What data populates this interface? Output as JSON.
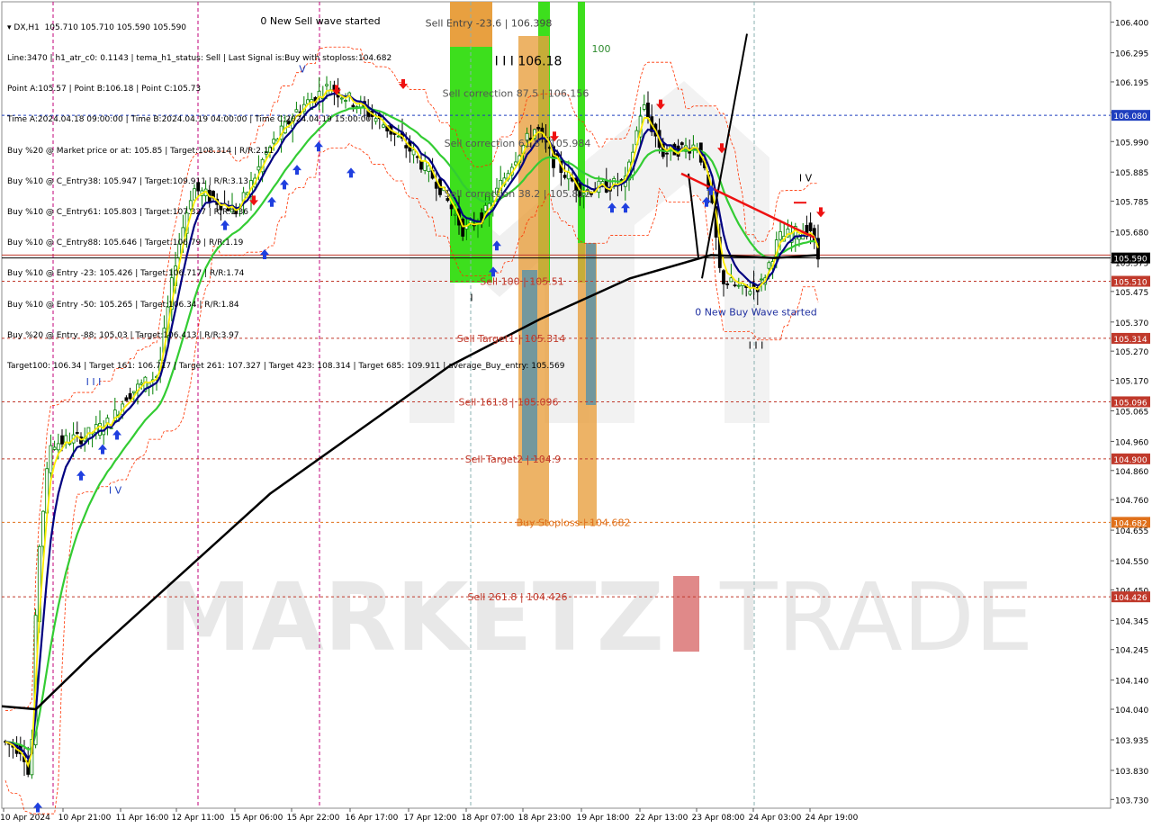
{
  "chart_data": {
    "type": "candlestick",
    "symbol": "DX,H1",
    "ohlc_header": "105.710 105.710 105.590 105.590",
    "ylim": [
      103.7,
      106.47
    ],
    "y_ticks": [
      106.4,
      106.295,
      106.195,
      106.09,
      105.99,
      105.885,
      105.785,
      105.68,
      105.575,
      105.475,
      105.37,
      105.27,
      105.17,
      105.065,
      104.96,
      104.86,
      104.76,
      104.655,
      104.55,
      104.45,
      104.345,
      104.245,
      104.14,
      104.04,
      103.935,
      103.83,
      103.73
    ],
    "y_tick_labels": [
      "106.400",
      "106.295",
      "106.195",
      "106.090",
      "105.990",
      "105.885",
      "105.785",
      "105.680",
      "105.575",
      "105.475",
      "105.370",
      "105.270",
      "105.170",
      "105.065",
      "104.960",
      "104.860",
      "104.760",
      "104.655",
      "104.550",
      "104.450",
      "104.345",
      "104.245",
      "104.140",
      "104.040",
      "103.935",
      "103.830",
      "103.730"
    ],
    "x_tick_labels": [
      "10 Apr 2024",
      "10 Apr 21:00",
      "11 Apr 16:00",
      "12 Apr 11:00",
      "15 Apr 06:00",
      "15 Apr 22:00",
      "16 Apr 17:00",
      "17 Apr 12:00",
      "18 Apr 07:00",
      "18 Apr 23:00",
      "19 Apr 18:00",
      "22 Apr 13:00",
      "23 Apr 08:00",
      "24 Apr 03:00",
      "24 Apr 19:00"
    ],
    "info_lines": [
      "Line:3470 | h1_atr_c0: 0.1143 | tema_h1_status: Sell | Last Signal is:Buy with stoploss:104.682",
      "Point A:105.57 | Point B:106.18 | Point C:105.73",
      "Time A:2024.04.18 09:00:00 | Time B:2024.04.19 04:00:00 | Time C:2024.04.19 15:00:00",
      "Buy %20 @ Market price or at: 105.85 | Target:108.314 | R/R:2.11",
      "Buy %10 @ C_Entry38: 105.947 | Target:109.911 | R/R:3.13",
      "Buy %10 @ C_Entry61: 105.803 | Target:107.327 | R/R:1.36",
      "Buy %10 @ C_Entry88: 105.646 | Target:106.79 | R/R:1.19",
      "Buy %10 @ Entry -23: 105.426 | Target:106.717 | R/R:1.74",
      "Buy %10 @ Entry -50: 105.265 | Target:106.34 | R/R:1.84",
      "Buy %20 @ Entry -88: 105.03 | Target:106.413 | R/R:3.97",
      "Target100: 106.34 | Target 161: 106.717 | Target 261: 107.327 | Target 423: 108.314 | Target 685: 109.911 | average_Buy_entry: 105.569"
    ],
    "price_levels": [
      {
        "label": "106.080",
        "value": 106.08,
        "color": "#1f3fbf"
      },
      {
        "label": "105.590",
        "value": 105.59,
        "color": "#000000"
      },
      {
        "label": "105.510",
        "value": 105.51,
        "color": "#c0392b"
      },
      {
        "label": "105.314",
        "value": 105.314,
        "color": "#c0392b"
      },
      {
        "label": "105.096",
        "value": 105.096,
        "color": "#c0392b"
      },
      {
        "label": "104.900",
        "value": 104.9,
        "color": "#c0392b"
      },
      {
        "label": "104.682",
        "value": 104.682,
        "color": "#e0701a"
      },
      {
        "label": "104.426",
        "value": 104.426,
        "color": "#c0392b"
      }
    ],
    "annotations": [
      {
        "text": "Sell Entry -23.6 | 106.398",
        "value": 106.398,
        "color": "#444444"
      },
      {
        "text": "I I I 106.18",
        "value": 106.265,
        "color": "#000000"
      },
      {
        "text": "100",
        "value": 106.31,
        "color": "#2e8b2e"
      },
      {
        "text": "Sell correction 87.5 | 106.156",
        "value": 106.156,
        "color": "#555555"
      },
      {
        "text": "Sell correction 61.8 | 105.984",
        "value": 105.984,
        "color": "#555555"
      },
      {
        "text": "Sell correction 38.2 | 105.812",
        "value": 105.812,
        "color": "#555555"
      },
      {
        "text": "Sell 100 | 105.51",
        "value": 105.51,
        "color": "#c0392b"
      },
      {
        "text": "Sell Target1 | 105.314",
        "value": 105.314,
        "color": "#c0392b"
      },
      {
        "text": "Sell 161.8 | 105.096",
        "value": 105.096,
        "color": "#c0392b"
      },
      {
        "text": "Sell Target2 | 104.9",
        "value": 104.9,
        "color": "#c0392b"
      },
      {
        "text": "Buy Stoploss | 104.682",
        "value": 104.682,
        "color": "#e0701a"
      },
      {
        "text": "Sell 261.8 | 104.426",
        "value": 104.426,
        "color": "#c0392b"
      },
      {
        "text": "0 New Sell wave started",
        "value": 106.405,
        "color": "#000000"
      },
      {
        "text": "0 New Buy Wave started",
        "value": 105.405,
        "color": "#1f2fa0"
      },
      {
        "text": "I V",
        "value": 105.866,
        "color": "#000000"
      },
      {
        "text": "V",
        "value": 106.24,
        "color": "#1f3fbf"
      },
      {
        "text": "I I I",
        "value": 105.165,
        "color": "#1f3fbf"
      },
      {
        "text": "I V",
        "value": 104.793,
        "color": "#1f3fbf"
      },
      {
        "text": "I I I",
        "value": 105.29,
        "color": "#000000"
      },
      {
        "text": "I",
        "value": 105.455,
        "color": "#000000"
      }
    ],
    "watermark": {
      "left": "MARKETZ",
      "right": "TRADE"
    },
    "colors": {
      "bull": "#008000",
      "bear": "#000000",
      "ema_fast": "#ffee00",
      "ema_mid": "#000080",
      "ema_slow": "#33cc33",
      "ma_long": "#000000",
      "envelope": "#ff3300",
      "arrow_up": "#1f3fdf",
      "arrow_down": "#ee1111"
    }
  }
}
